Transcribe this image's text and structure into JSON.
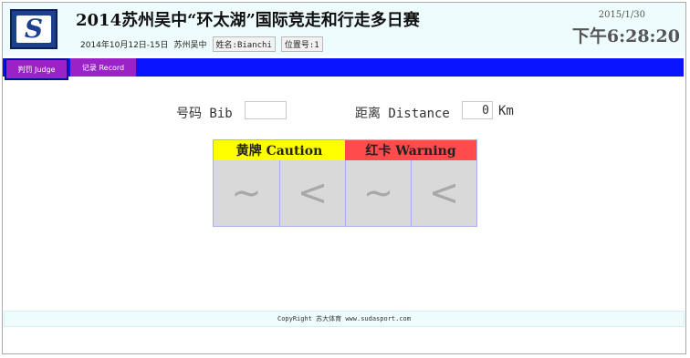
{
  "header": {
    "logo_letter": "S",
    "title": "2014苏州吴中“环太湖”国际竞走和行走多日赛",
    "date_range": "2014年10月12日-15日",
    "location": "苏州吴中",
    "name_chip": "姓名:Bianchi",
    "position_chip": "位置号:1",
    "date": "2015/1/30",
    "time": "下午6:28:20"
  },
  "nav": {
    "tabs": [
      {
        "label": "判罚 Judge",
        "active": true
      },
      {
        "label": "记录 Record",
        "active": false
      }
    ],
    "bar_color": "#0a14ff",
    "tab_color": "#9b22c6"
  },
  "form": {
    "bib_label": "号码 Bib",
    "bib_value": "",
    "distance_label": "距离 Distance",
    "distance_value": "0",
    "unit": "Km"
  },
  "penalty": {
    "caution_label": "黄牌 Caution",
    "warning_label": "红卡 Warning",
    "caution_color": "#ffff00",
    "warning_color": "#ff4b4b",
    "buttons": [
      {
        "symbol": "~",
        "meaning": "loss-of-contact"
      },
      {
        "symbol": "<",
        "meaning": "bent-knee"
      },
      {
        "symbol": "~",
        "meaning": "loss-of-contact"
      },
      {
        "symbol": "<",
        "meaning": "bent-knee"
      }
    ]
  },
  "footer": {
    "text": "CopyRight 苏大体育 www.sudasport.com"
  }
}
